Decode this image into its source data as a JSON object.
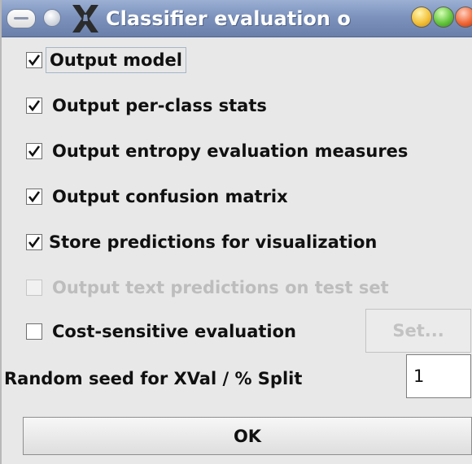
{
  "window": {
    "title": "Classifier evaluation o",
    "icons": [
      "window-menu-icon",
      "shade-icon",
      "x11-logo-icon",
      "minimize-icon",
      "maximize-icon",
      "close-icon"
    ]
  },
  "options": [
    {
      "label": "Output model",
      "checked": true,
      "enabled": true
    },
    {
      "label": "Output per-class stats",
      "checked": true,
      "enabled": true
    },
    {
      "label": "Output entropy evaluation measures",
      "checked": true,
      "enabled": true
    },
    {
      "label": "Output confusion matrix",
      "checked": true,
      "enabled": true
    },
    {
      "label": "Store predictions for visualization",
      "checked": true,
      "enabled": true
    },
    {
      "label": "Output text predictions on test set",
      "checked": false,
      "enabled": false
    },
    {
      "label": "Cost-sensitive evaluation",
      "checked": false,
      "enabled": true
    }
  ],
  "set_button": {
    "label": "Set...",
    "enabled": false
  },
  "seed": {
    "label": "Random seed for XVal / % Split",
    "value": "1"
  },
  "ok_button": {
    "label": "OK"
  },
  "colors": {
    "titlebar": "#7d93bd",
    "background": "#e8e8e8",
    "disabled_text": "#bdbdbd"
  }
}
